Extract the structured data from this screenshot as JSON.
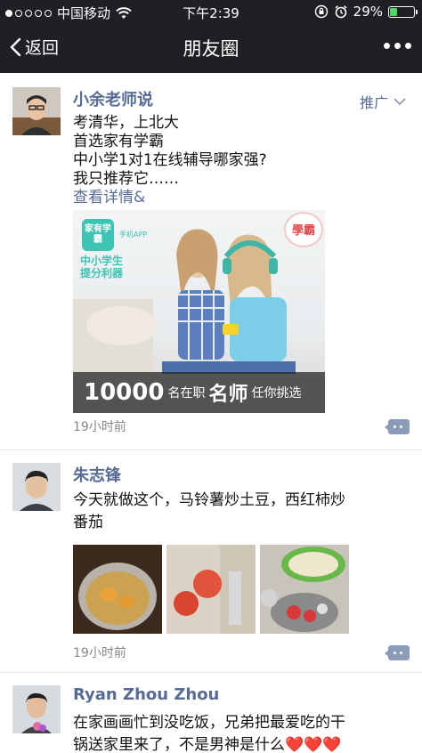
{
  "status_bar": {
    "carrier": "中国移动",
    "time": "下午2:39",
    "battery": "29%",
    "battery_level": 0.29
  },
  "nav": {
    "back_label": "返回",
    "title": "朋友圈"
  },
  "posts": [
    {
      "author": "小余老师说",
      "promo_label": "推广",
      "lines": [
        "考清华，上北大",
        "首选家有学霸",
        "中小学1对1在线辅导哪家强?",
        "我只推荐它……"
      ],
      "link": "查看详情&",
      "ad": {
        "logo_text": "家有学霸",
        "app_label": "手机APP",
        "slogan_line1": "中小学生",
        "slogan_line2": "提分利器",
        "badge": "學霸",
        "banner_num": "10000",
        "banner_mid": "名在职",
        "banner_big": "名师",
        "banner_end": "任你挑选"
      },
      "time_ago": "19小时前"
    },
    {
      "author": "朱志锋",
      "lines": [
        "今天就做这个，马铃薯炒土豆，西红柿炒",
        "番茄"
      ],
      "time_ago": "19小时前"
    },
    {
      "author": "Ryan Zhou Zhou",
      "lines": [
        "在家画画忙到没吃饭，兄弟把最爱吃的干",
        "锅送家里来了，不是男神是什么❤️❤️❤️"
      ]
    }
  ],
  "colors": {
    "bar_bg": "#1f1f24",
    "name_blue": "#576b95",
    "brand_teal": "#3dc4b2"
  }
}
